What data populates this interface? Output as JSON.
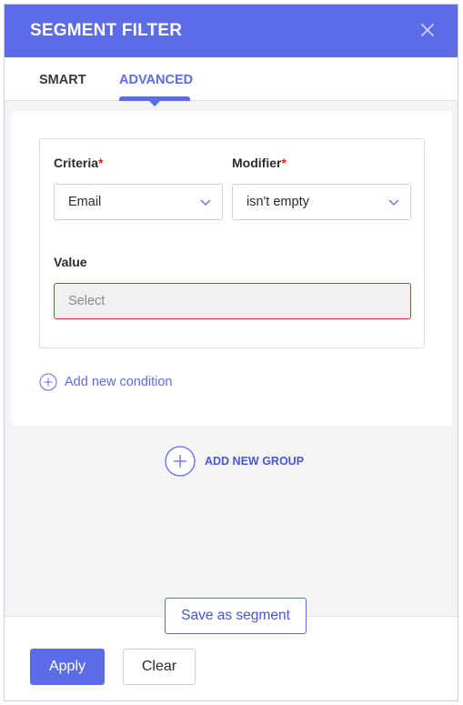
{
  "header": {
    "title": "SEGMENT FILTER",
    "close_icon": "close-icon"
  },
  "tabs": [
    {
      "label": "SMART",
      "active": false
    },
    {
      "label": "ADVANCED",
      "active": true
    }
  ],
  "condition": {
    "criteria_label": "Criteria",
    "criteria_required_mark": "*",
    "criteria_value": "Email",
    "modifier_label": "Modifier",
    "modifier_required_mark": "*",
    "modifier_value": "isn't empty",
    "value_label": "Value",
    "value_placeholder": "Select"
  },
  "actions": {
    "add_condition_label": "Add new condition",
    "add_group_label": "ADD NEW GROUP",
    "save_segment_label": "Save as segment",
    "apply_label": "Apply",
    "clear_label": "Clear"
  },
  "colors": {
    "accent": "#5b6ce6",
    "error": "#d63030",
    "required": "#e02424"
  }
}
